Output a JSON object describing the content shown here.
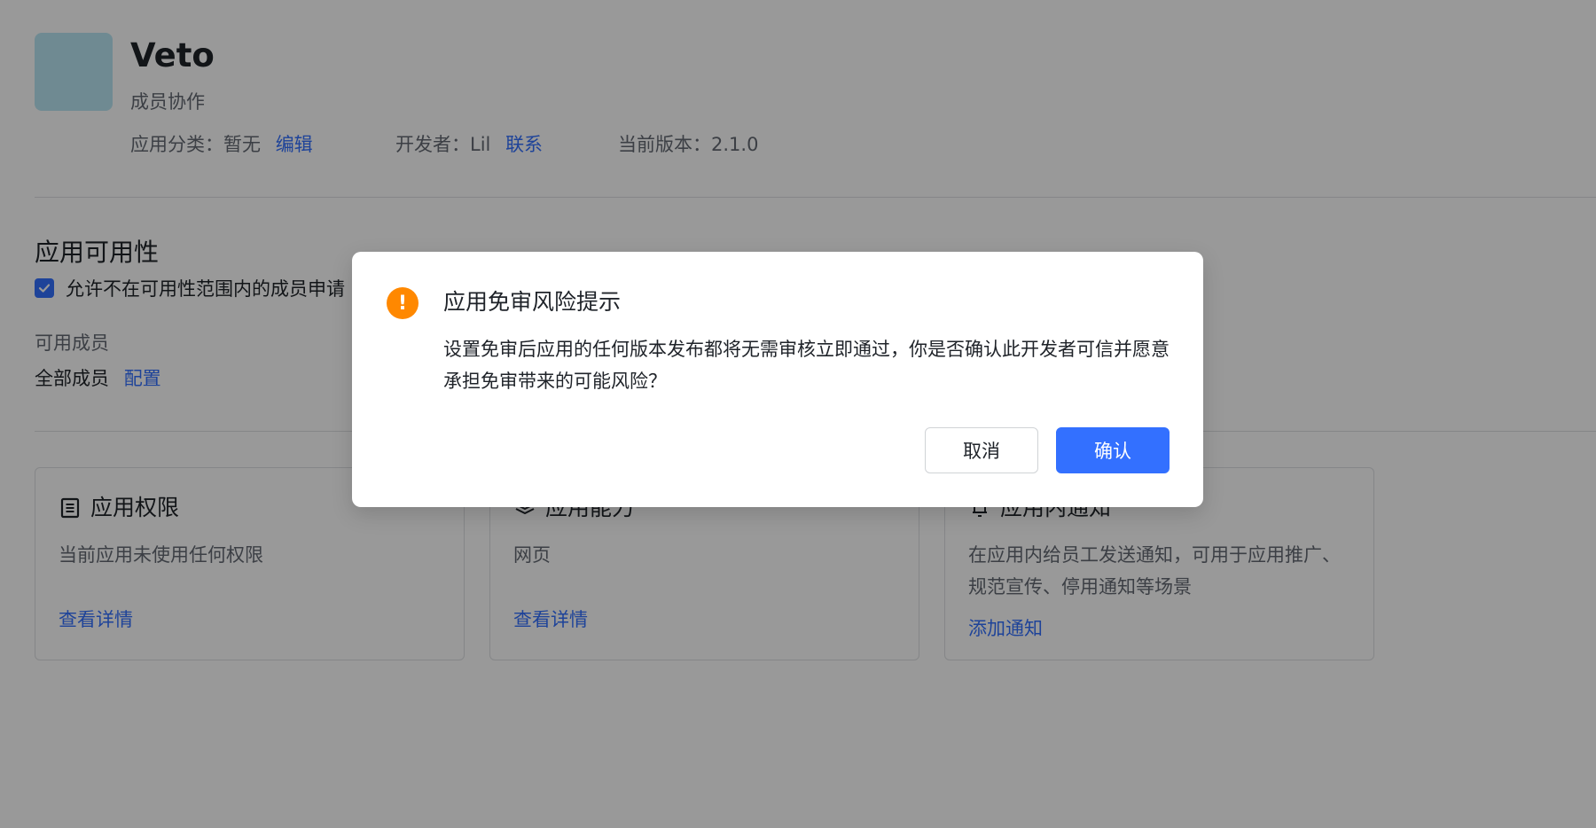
{
  "colors": {
    "accent": "#3370ff",
    "warning": "#ff8800",
    "app_icon": "#b9e7f3",
    "overlay": "rgba(0,0,0,0.4)"
  },
  "app": {
    "name": "Veto",
    "description": "成员协作",
    "category_label": "应用分类：",
    "category_value": "暂无",
    "category_edit": "编辑",
    "developer_label": "开发者：",
    "developer_value": "Lil",
    "developer_contact": "联系",
    "version_label": "当前版本：",
    "version_value": "2.1.0"
  },
  "availability": {
    "title": "应用可用性",
    "checkbox_label": "允许不在可用性范围内的成员申请",
    "checked": true,
    "members_label": "可用成员",
    "members_value": "全部成员",
    "members_config": "配置"
  },
  "cards": [
    {
      "icon": "document-list-icon",
      "title": "应用权限",
      "description": "当前应用未使用任何权限",
      "link": "查看详情"
    },
    {
      "icon": "layers-icon",
      "title": "应用能力",
      "description": "网页",
      "link": "查看详情"
    },
    {
      "icon": "bell-icon",
      "title": "应用内通知",
      "description": "在应用内给员工发送通知，可用于应用推广、规范宣传、停用通知等场景",
      "link": "添加通知"
    }
  ],
  "modal": {
    "icon": "warning-icon",
    "icon_glyph": "!",
    "title": "应用免审风险提示",
    "body": "设置免审后应用的任何版本发布都将无需审核立即通过，你是否确认此开发者可信并愿意承担免审带来的可能风险？",
    "cancel_label": "取消",
    "confirm_label": "确认"
  }
}
